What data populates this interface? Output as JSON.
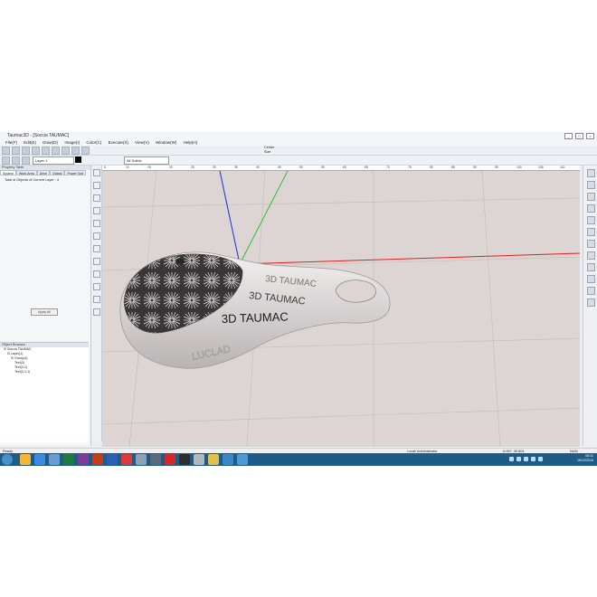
{
  "window": {
    "title": "Taumac3D - [Soccia TAUMAC]",
    "menus": [
      "File(F)",
      "Edit(E)",
      "Draw(D)",
      "Image(I)",
      "Color(C)",
      "Execute(X)",
      "View(V)",
      "Window(W)",
      "Help(H)"
    ]
  },
  "toolbar": {
    "layer_select": "Layer 1",
    "object_filter": "All Solids",
    "center_label": "Center",
    "size_label": "Size"
  },
  "properties": {
    "header": "Property Table",
    "tabs": [
      "System",
      "Work Area",
      "Drive",
      "Global",
      "Power Tool"
    ],
    "active_tab": "System",
    "total_objects": "Total of Objects of Current Layer : 4",
    "apply_button": "Apply All"
  },
  "object_browser": {
    "header": "Object Browser",
    "tree": [
      "Soccia TAUMAC",
      "Layer(1)",
      "Group(4)",
      "Text(3)",
      "Text(3-1)",
      "Text(3-1-1)"
    ]
  },
  "ruler": {
    "ticks": [
      "5",
      "10",
      "15",
      "20",
      "25",
      "30",
      "35",
      "40",
      "45",
      "50",
      "55",
      "60",
      "65",
      "70",
      "75",
      "80",
      "85",
      "90",
      "95",
      "100",
      "105",
      "110"
    ]
  },
  "model": {
    "labels": [
      "3D TAUMAC",
      "3D TAUMAC",
      "3D TAUMAC",
      "LUCLAD"
    ],
    "axis_colors": {
      "x": "#e0201b",
      "y": "#2ac23a",
      "z": "#1d2fd6"
    }
  },
  "status": {
    "left": "Ready",
    "user": "Local\\ Administrator",
    "coords": "-5.967 ,30.804",
    "mode": "NUM"
  },
  "taskbar": {
    "time": "08:11",
    "date": "16/12/2016"
  }
}
